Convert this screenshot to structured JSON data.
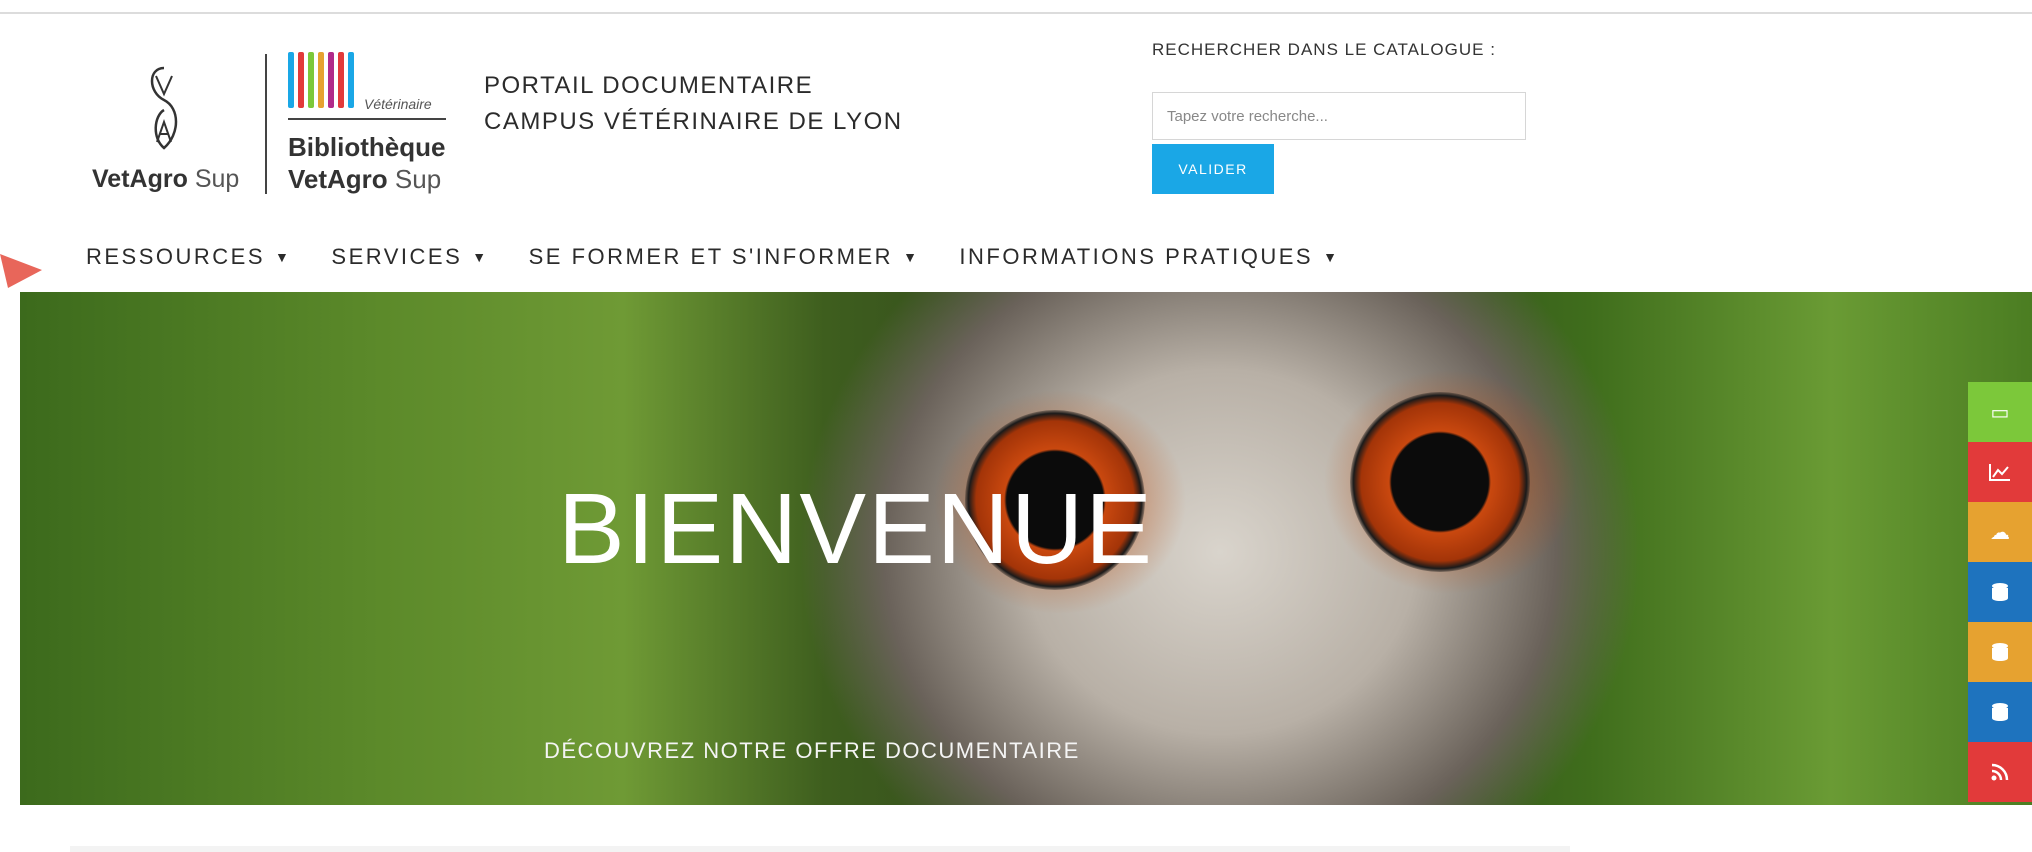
{
  "header": {
    "logo_brand_bold": "VetAgro",
    "logo_brand_light": "Sup",
    "biblio_small": "Vétérinaire",
    "biblio_name": "Bibliothèque",
    "biblio_brand_bold": "VetAgro",
    "biblio_brand_light": "Sup",
    "portal_line1": "PORTAIL DOCUMENTAIRE",
    "portal_line2": "CAMPUS VÉTÉRINAIRE DE LYON"
  },
  "search": {
    "label": "RECHERCHER DANS LE CATALOGUE :",
    "placeholder": "Tapez votre recherche...",
    "submit_label": "VALIDER"
  },
  "nav": {
    "items": [
      {
        "label": "RESSOURCES"
      },
      {
        "label": "SERVICES"
      },
      {
        "label": "SE FORMER ET S'INFORMER"
      },
      {
        "label": "INFORMATIONS PRATIQUES"
      }
    ]
  },
  "hero": {
    "title": "BIENVENUE",
    "cta": "DÉCOUVREZ NOTRE OFFRE DOCUMENTAIRE"
  },
  "side_widget": {
    "buttons": [
      {
        "icon": "book-icon",
        "color": "#7cc83a"
      },
      {
        "icon": "chart-icon",
        "color": "#e23a3a"
      },
      {
        "icon": "cloud-icon",
        "color": "#e6a230"
      },
      {
        "icon": "database-icon",
        "color": "#1e73be"
      },
      {
        "icon": "database-icon",
        "color": "#e6a230"
      },
      {
        "icon": "database-icon",
        "color": "#1e73be"
      },
      {
        "icon": "rss-icon",
        "color": "#e23a3a"
      }
    ]
  },
  "colors": {
    "accent": "#1aa7e6",
    "text": "#2b2b2b"
  }
}
